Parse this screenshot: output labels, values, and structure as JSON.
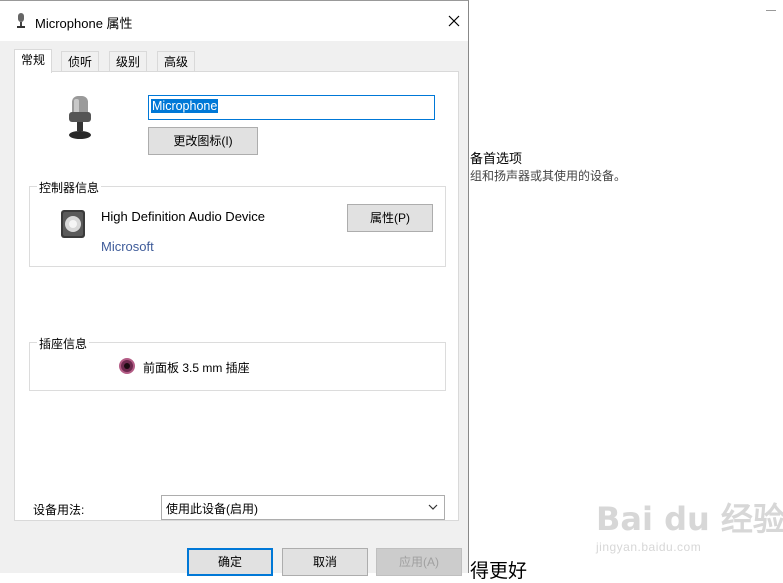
{
  "window": {
    "title": "Microphone 属性",
    "close_glyph": "✕"
  },
  "tabs": [
    {
      "label": "常规",
      "active": true
    },
    {
      "label": "侦听",
      "active": false
    },
    {
      "label": "级别",
      "active": false
    },
    {
      "label": "高级",
      "active": false
    }
  ],
  "general": {
    "device_name_value": "Microphone",
    "change_icon_label": "更改图标(I)",
    "controller_group_label": "控制器信息",
    "controller_name": "High Definition Audio Device",
    "controller_manufacturer": "Microsoft",
    "properties_label": "属性(P)",
    "jack_group_label": "插座信息",
    "jack_text": "前面板 3.5 mm 插座",
    "jack_color": "#b45d86",
    "usage_label": "设备用法:",
    "usage_value": "使用此设备(启用)"
  },
  "buttons": {
    "ok": "确定",
    "cancel": "取消",
    "apply": "应用(A)"
  },
  "background": {
    "heading": "备首选项",
    "description": "组和扬声器或其使用的设备。",
    "bottom_text": "得更好"
  },
  "watermark": {
    "logo": "Bai du 经验",
    "url": "jingyan.baidu.com"
  },
  "colors": {
    "accent": "#0078d7",
    "link": "#3f5c9a"
  }
}
